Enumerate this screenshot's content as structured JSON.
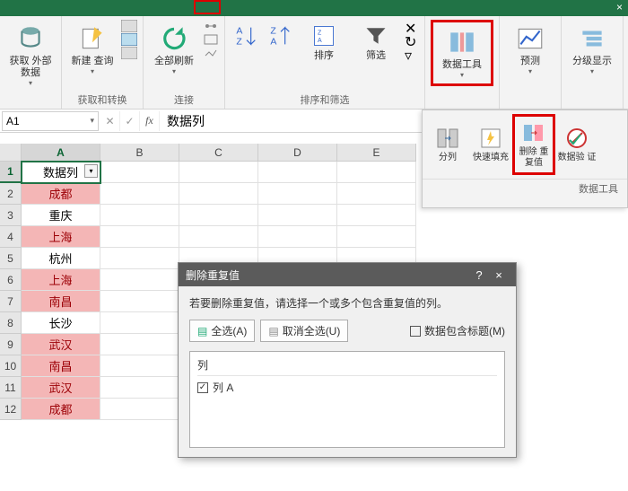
{
  "ribbon": {
    "groups": [
      {
        "label": "",
        "buttons": [
          {
            "label": "获取\n外部数据"
          }
        ]
      },
      {
        "label": "获取和转换",
        "buttons": [
          {
            "label": "新建\n查询"
          }
        ]
      },
      {
        "label": "连接",
        "buttons": [
          {
            "label": "全部刷新"
          }
        ]
      },
      {
        "label": "排序和筛选",
        "buttons": [
          {
            "label": "排序"
          },
          {
            "label": "筛选"
          }
        ]
      },
      {
        "label": "",
        "buttons": [
          {
            "label": "数据工具"
          }
        ]
      },
      {
        "label": "",
        "buttons": [
          {
            "label": "预测"
          }
        ]
      },
      {
        "label": "",
        "buttons": [
          {
            "label": "分级显示"
          }
        ]
      }
    ],
    "sub": {
      "group_label": "数据工具",
      "buttons": [
        {
          "label": "分列"
        },
        {
          "label": "快速填充"
        },
        {
          "label": "删除\n重复值"
        },
        {
          "label": "数据验\n证"
        }
      ]
    }
  },
  "formula_bar": {
    "name_box": "A1",
    "fx": "数据列"
  },
  "grid": {
    "columns": [
      "A",
      "B",
      "C",
      "D",
      "E"
    ],
    "rows": [
      1,
      2,
      3,
      4,
      5,
      6,
      7,
      8,
      9,
      10,
      11,
      12
    ],
    "data": [
      {
        "v": "数据列",
        "dup": false,
        "header": true
      },
      {
        "v": "成都",
        "dup": true
      },
      {
        "v": "重庆",
        "dup": false
      },
      {
        "v": "上海",
        "dup": true
      },
      {
        "v": "杭州",
        "dup": false
      },
      {
        "v": "上海",
        "dup": true
      },
      {
        "v": "南昌",
        "dup": true
      },
      {
        "v": "长沙",
        "dup": false
      },
      {
        "v": "武汉",
        "dup": true
      },
      {
        "v": "南昌",
        "dup": true
      },
      {
        "v": "武汉",
        "dup": true
      },
      {
        "v": "成都",
        "dup": true
      }
    ]
  },
  "dialog": {
    "title": "删除重复值",
    "message": "若要删除重复值，请选择一个或多个包含重复值的列。",
    "select_all": "全选(A)",
    "unselect_all": "取消全选(U)",
    "headers_checkbox": "数据包含标题(M)",
    "list_header": "列",
    "items": [
      "列 A"
    ]
  }
}
